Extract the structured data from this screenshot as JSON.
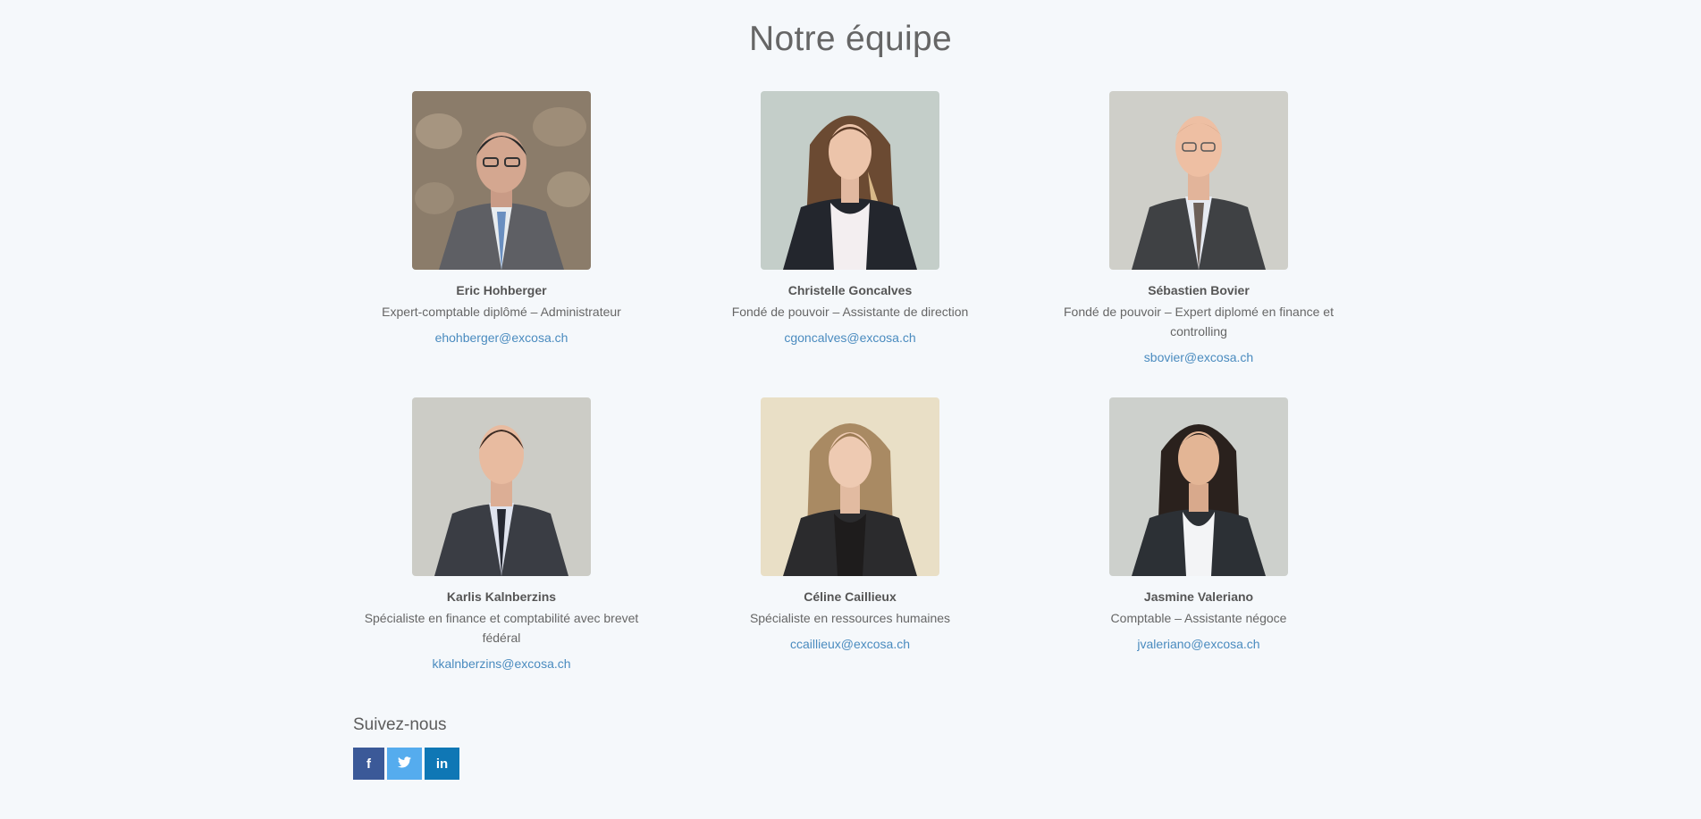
{
  "page": {
    "title": "Notre équipe"
  },
  "team": [
    {
      "name": "Eric Hohberger",
      "role": "Expert-comptable diplômé – Administrateur",
      "email": "ehohberger@excosa.ch"
    },
    {
      "name": "Christelle Goncalves",
      "role": "Fondé de pouvoir – Assistante de direction",
      "email": "cgoncalves@excosa.ch"
    },
    {
      "name": "Sébastien Bovier",
      "role": "Fondé de pouvoir – Expert diplomé en finance et controlling",
      "email": "sbovier@excosa.ch"
    },
    {
      "name": "Karlis Kalnberzins",
      "role": "Spécialiste en finance et comptabilité avec brevet fédéral",
      "email": "kkalnberzins@excosa.ch"
    },
    {
      "name": "Céline Caillieux",
      "role": "Spécialiste en ressources humaines",
      "email": "ccaillieux@excosa.ch"
    },
    {
      "name": "Jasmine Valeriano",
      "role": "Comptable – Assistante négoce",
      "email": "jvaleriano@excosa.ch"
    }
  ],
  "follow": {
    "title": "Suivez-nous",
    "facebook_icon": "facebook-icon",
    "twitter_icon": "twitter-icon",
    "linkedin_icon": "linkedin-icon",
    "facebook_color": "#3b5998",
    "twitter_color": "#55acee",
    "linkedin_color": "#0f77b5"
  }
}
